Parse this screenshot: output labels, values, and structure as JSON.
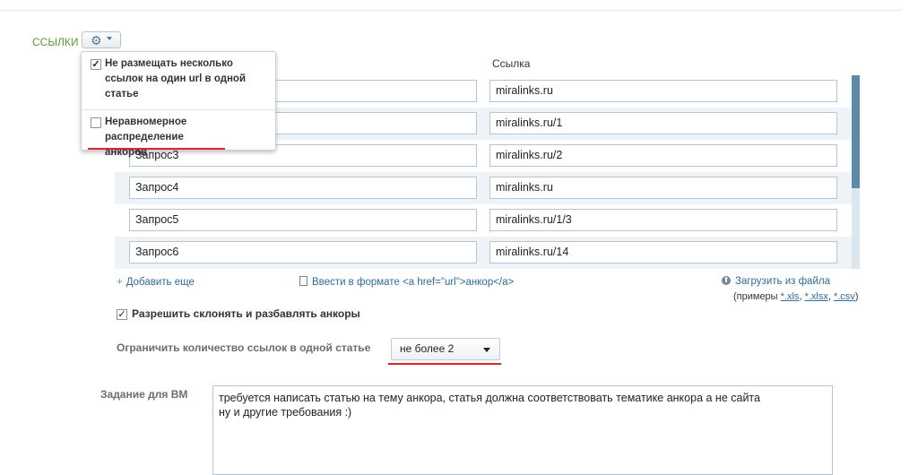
{
  "section": {
    "title": "ССЫЛКИ"
  },
  "settings_menu": {
    "items": [
      {
        "label": "Не размещать несколько ссылок на один url в одной статье",
        "checked": true
      },
      {
        "label": "Неравномерное распределение анкоров",
        "checked": false
      }
    ]
  },
  "table": {
    "link_header": "Ссылка",
    "rows": [
      {
        "query": "",
        "link": "miralinks.ru"
      },
      {
        "query": "",
        "link": "miralinks.ru/1"
      },
      {
        "query": "Запрос3",
        "link": "miralinks.ru/2"
      },
      {
        "query": "Запрос4",
        "link": "miralinks.ru"
      },
      {
        "query": "Запрос5",
        "link": "miralinks.ru/1/3"
      },
      {
        "query": "Запрос6",
        "link": "miralinks.ru/14"
      }
    ]
  },
  "actions": {
    "add_more_label": "Добавить еще",
    "format_label": "Ввести в формате <a href=\"url\">анкор</a>",
    "upload_label": "Загрузить из файла",
    "examples_prefix": "(примеры",
    "examples": [
      "*.xls",
      "*.xlsx",
      "*.csv"
    ],
    "examples_suffix": ")"
  },
  "options": {
    "allow_anchors_label": "Разрешить склонять и разбавлять анкоры",
    "allow_anchors_checked": true,
    "limit_label": "Ограничить количество ссылок в одной статье",
    "limit_value": "не более 2"
  },
  "task": {
    "label": "Задание для ВМ",
    "text": "требуется написать статью на тему анкора, статья должна соответствовать тематике анкора а не сайта\nну и другие требования :)"
  },
  "colors": {
    "accent": "#5b9a30",
    "link": "#2f6c99",
    "highlight": "#e0242b"
  },
  "icons": {
    "settings": "gear-icon",
    "add": "plus-icon",
    "format": "document-icon",
    "upload": "upload-icon"
  }
}
